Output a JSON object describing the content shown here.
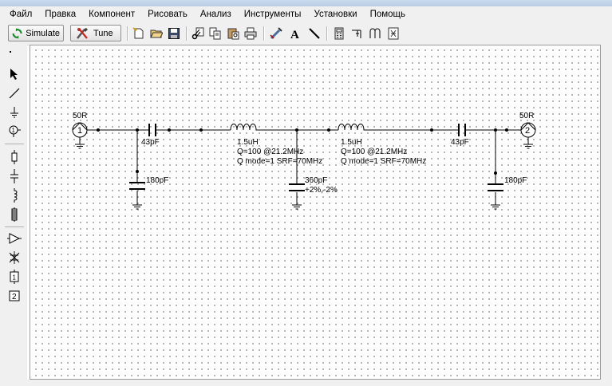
{
  "menu": [
    {
      "label": "Файл"
    },
    {
      "label": "Правка"
    },
    {
      "label": "Компонент"
    },
    {
      "label": "Рисовать"
    },
    {
      "label": "Анализ"
    },
    {
      "label": "Инструменты"
    },
    {
      "label": "Установки"
    },
    {
      "label": "Помощь"
    }
  ],
  "toolbar": {
    "simulate_label": "Simulate",
    "tune_label": "Tune"
  },
  "circuit": {
    "port1": {
      "number": "1",
      "impedance": "50R"
    },
    "port2": {
      "number": "2",
      "impedance": "50R"
    },
    "c_series_left": {
      "value": "43pF"
    },
    "c_shunt_left": {
      "value": "180pF"
    },
    "l1": {
      "value": "1.5uH",
      "q": "Q=100 @21.2MHz",
      "mode": "Q mode=1 SRF=70MHz"
    },
    "c_shunt_mid": {
      "value": "360pF",
      "tolerance": "+2%,-2%"
    },
    "l2": {
      "value": "1.5uH",
      "q": "Q=100 @21.2MHz",
      "mode": "Q mode=1 SRF=70MHz"
    },
    "c_series_right": {
      "value": "43pF"
    },
    "c_shunt_right": {
      "value": "180pF"
    }
  },
  "tools": {
    "port_number": "2",
    "subckt_label": "1"
  }
}
